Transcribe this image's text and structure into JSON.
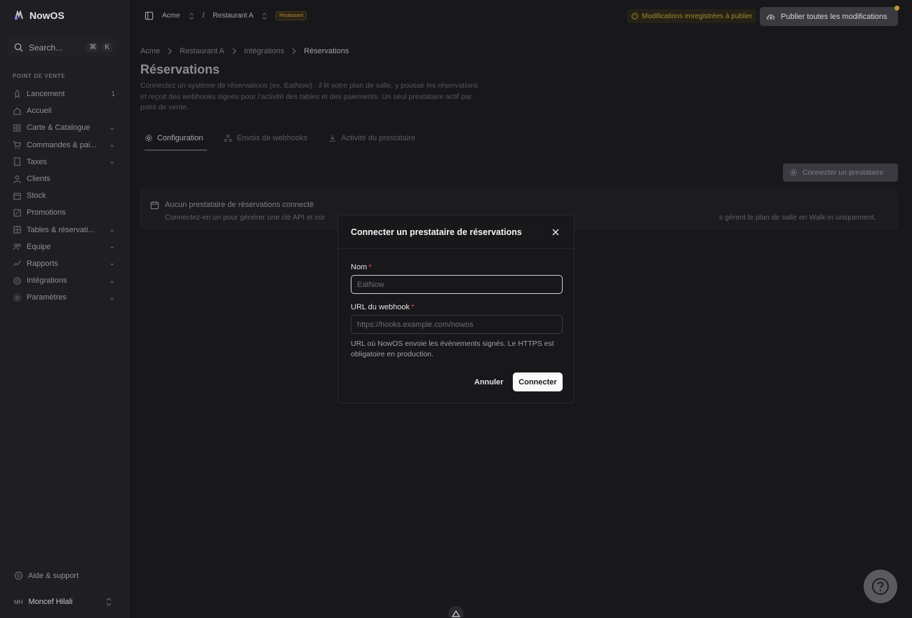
{
  "app": {
    "name": "NowOS"
  },
  "search": {
    "label": "Search...",
    "kbd1": "⌘",
    "kbd2": "K"
  },
  "sidebar": {
    "section": "POINT DE VENTE",
    "items": [
      {
        "label": "Lancement",
        "trail": "1"
      },
      {
        "label": "Accueil",
        "trail": ""
      },
      {
        "label": "Carte & Catalogue",
        "trail": "⌄"
      },
      {
        "label": "Commandes & pai...",
        "trail": "⌄"
      },
      {
        "label": "Taxes",
        "trail": "⌄"
      },
      {
        "label": "Clients",
        "trail": ""
      },
      {
        "label": "Stock",
        "trail": ""
      },
      {
        "label": "Promotions",
        "trail": ""
      },
      {
        "label": "Tables & réservati...",
        "trail": "⌄"
      },
      {
        "label": "Équipe",
        "trail": "⌄"
      },
      {
        "label": "Rapports",
        "trail": "⌄"
      },
      {
        "label": "Intégrations",
        "trail": "⌄"
      },
      {
        "label": "Paramètres",
        "trail": "⌄"
      }
    ],
    "help": "Aide & support",
    "user": {
      "initials": "MH",
      "name": "Moncef Hilali"
    }
  },
  "topbar": {
    "org": "Acme",
    "sep": "/",
    "store": "Restaurant A",
    "tag": "Restaurant",
    "unsaved": "Modifications enregistrées à publier",
    "publish": "Publier toutes les modifications"
  },
  "breadcrumb": [
    "Acme",
    "Restaurant A",
    "Intégrations",
    "Réservations"
  ],
  "page": {
    "title": "Réservations",
    "description": "Connectez un système de réservations (ex. EatNow) : il lit votre plan de salle, y pousse les réservations et reçoit des webhooks signés pour l'activité des tables et des paiements. Un seul prestataire actif par point de vente."
  },
  "tabs": [
    {
      "label": "Configuration"
    },
    {
      "label": "Envois de webhooks"
    },
    {
      "label": "Activité du prestataire"
    }
  ],
  "connect_button": "Connecter un prestataire",
  "empty": {
    "title": "Aucun prestataire de réservations connecté",
    "text_left": "Connectez-en un pour générer une clé API et cor",
    "text_right": "s gèrent le plan de salle en Walk-in uniquement."
  },
  "modal": {
    "title": "Connecter un prestataire de réservations",
    "name_label": "Nom",
    "name_placeholder": "EatNow",
    "url_label": "URL du webhook",
    "url_placeholder": "https://hooks.example.com/nowos",
    "hint": "URL où NowOS envoie les événements signés. Le HTTPS est obligatoire en production.",
    "cancel": "Annuler",
    "connect": "Connecter"
  }
}
